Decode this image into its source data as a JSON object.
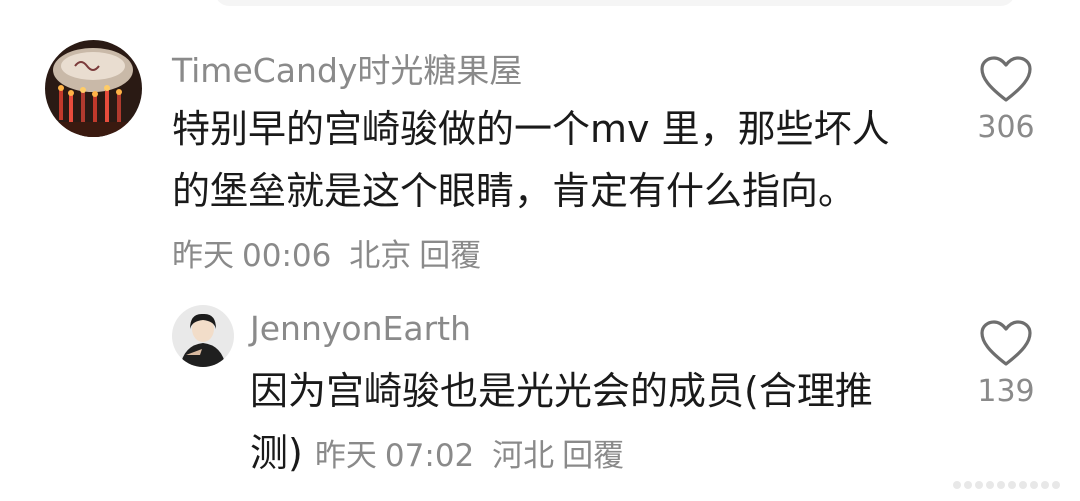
{
  "comments": [
    {
      "username": "TimeCandy时光糖果屋",
      "text": "特别早的宫崎骏做的一个mv 里，那些坏人的堡垒就是这个眼睛，肯定有什么指向。",
      "date": "昨天",
      "time": "00:06",
      "location": "北京",
      "reply_label": "回覆",
      "likes": "306",
      "avatar_icon": "birthday-cake-candles-avatar"
    },
    {
      "username": "JennyonEarth",
      "text": "因为宫崎骏也是光光会的成员(合理推测)",
      "date": "昨天",
      "time": "07:02",
      "location": "河北",
      "reply_label": "回覆",
      "likes": "139",
      "avatar_icon": "person-portrait-avatar"
    }
  ],
  "colors": {
    "meta_gray": "#8a8a8a",
    "text_dark": "#1a1a1a"
  }
}
